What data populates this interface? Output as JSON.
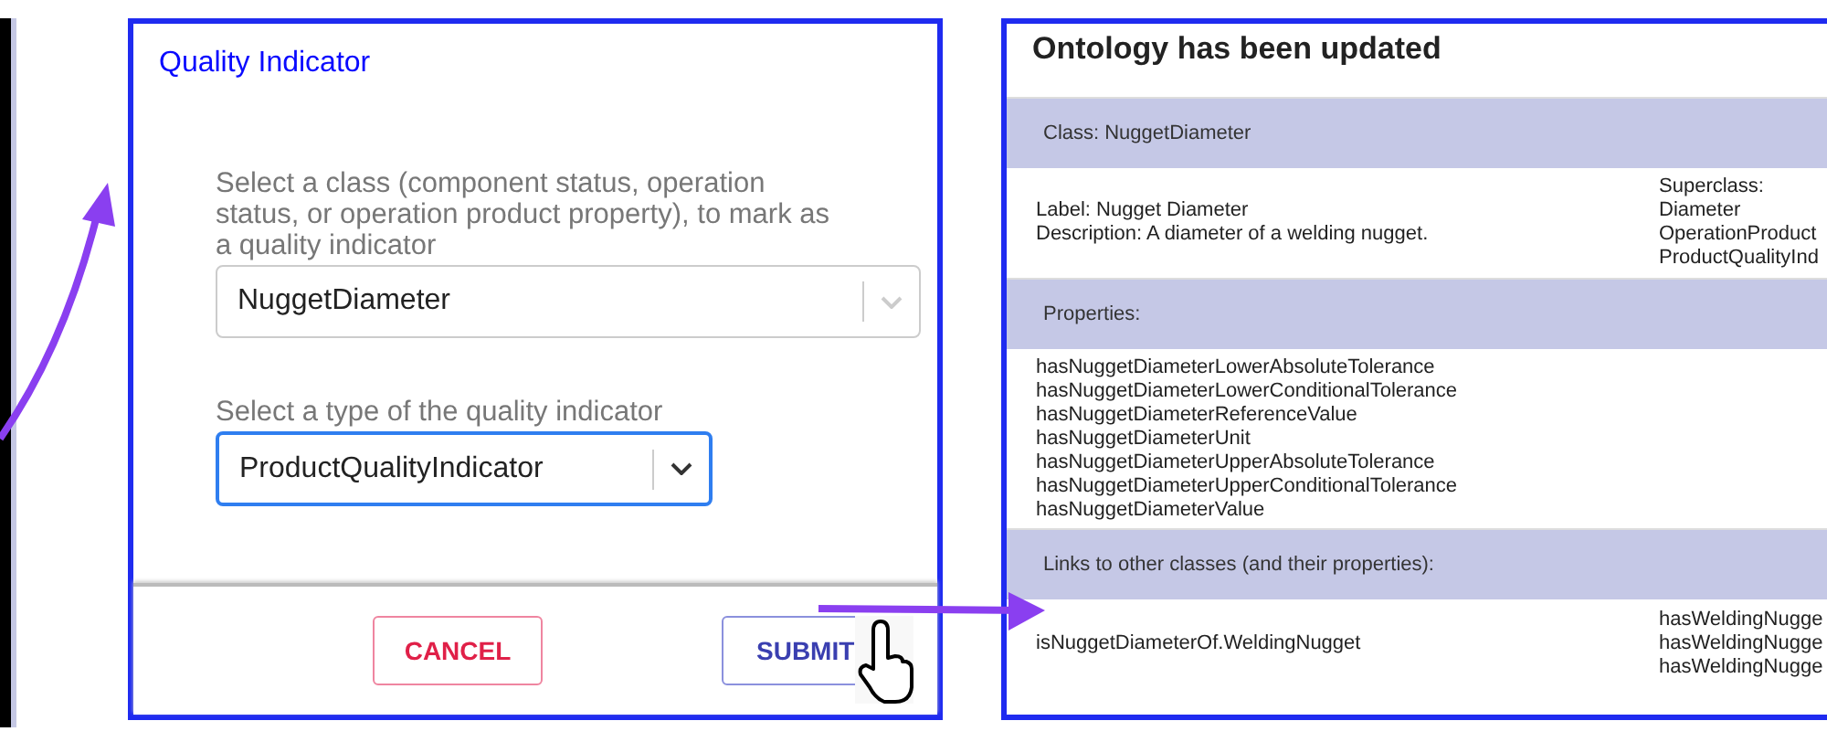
{
  "dialog": {
    "title": "Quality Indicator",
    "fields": [
      {
        "label": "Select a class (component status, operation status, or operation product property), to mark as a quality indicator",
        "value": "NuggetDiameter",
        "focused": false
      },
      {
        "label": "Select a type of the quality indicator",
        "value": "ProductQualityIndicator",
        "focused": true
      }
    ],
    "buttons": [
      {
        "label": "CANCEL",
        "kind": "cancel"
      },
      {
        "label": "SUBMIT",
        "kind": "submit"
      }
    ]
  },
  "result": {
    "title": "Ontology has been updated",
    "sections": [
      {
        "kind": "header",
        "text": "Class: NuggetDiameter"
      },
      {
        "kind": "detail",
        "left": [
          "Label: Nugget Diameter",
          "Description: A diameter of a welding nugget."
        ],
        "right": [
          "Superclass:",
          "Diameter",
          "OperationProduct",
          "ProductQualityInd"
        ]
      },
      {
        "kind": "header",
        "text": "Properties:"
      },
      {
        "kind": "list",
        "left": [
          "hasNuggetDiameterLowerAbsoluteTolerance",
          "hasNuggetDiameterLowerConditionalTolerance",
          "hasNuggetDiameterReferenceValue",
          "hasNuggetDiameterUnit",
          "hasNuggetDiameterUpperAbsoluteTolerance",
          "hasNuggetDiameterUpperConditionalTolerance",
          "hasNuggetDiameterValue"
        ]
      },
      {
        "kind": "header",
        "text": "Links to other classes (and their properties):"
      },
      {
        "kind": "detail",
        "left": [
          "isNuggetDiameterOf.WeldingNugget"
        ],
        "right": [
          "hasWeldingNugge",
          "hasWeldingNugge",
          "hasWeldingNugge"
        ]
      }
    ]
  }
}
